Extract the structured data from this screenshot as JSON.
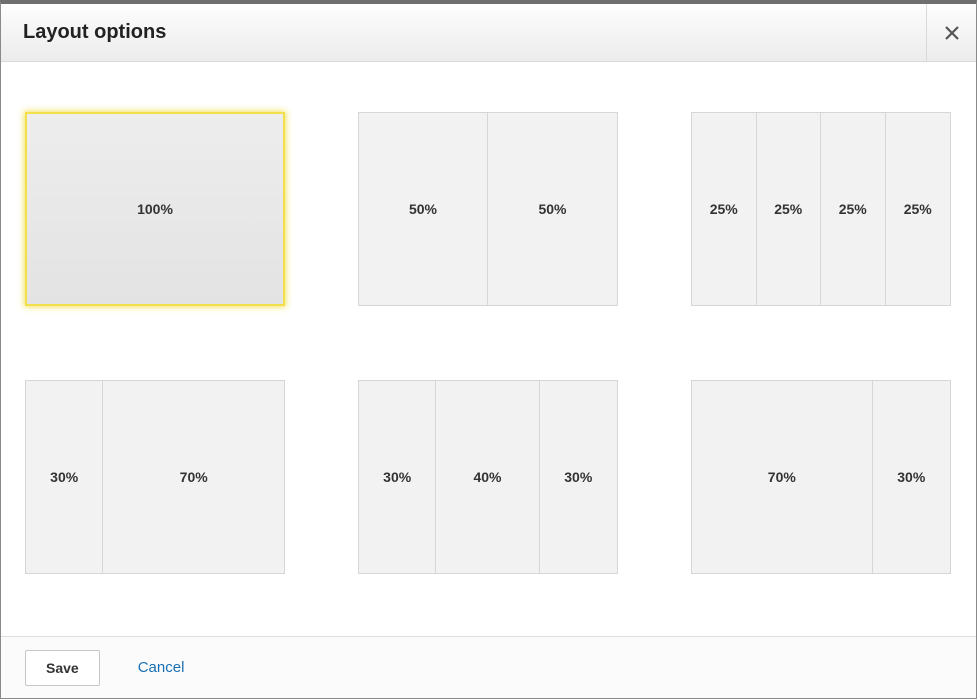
{
  "header": {
    "title": "Layout options"
  },
  "options": [
    {
      "selected": true,
      "columns": [
        "100%"
      ]
    },
    {
      "selected": false,
      "columns": [
        "50%",
        "50%"
      ]
    },
    {
      "selected": false,
      "columns": [
        "25%",
        "25%",
        "25%",
        "25%"
      ]
    },
    {
      "selected": false,
      "columns": [
        "30%",
        "70%"
      ]
    },
    {
      "selected": false,
      "columns": [
        "30%",
        "40%",
        "30%"
      ]
    },
    {
      "selected": false,
      "columns": [
        "70%",
        "30%"
      ]
    }
  ],
  "footer": {
    "save_label": "Save",
    "cancel_label": "Cancel"
  }
}
